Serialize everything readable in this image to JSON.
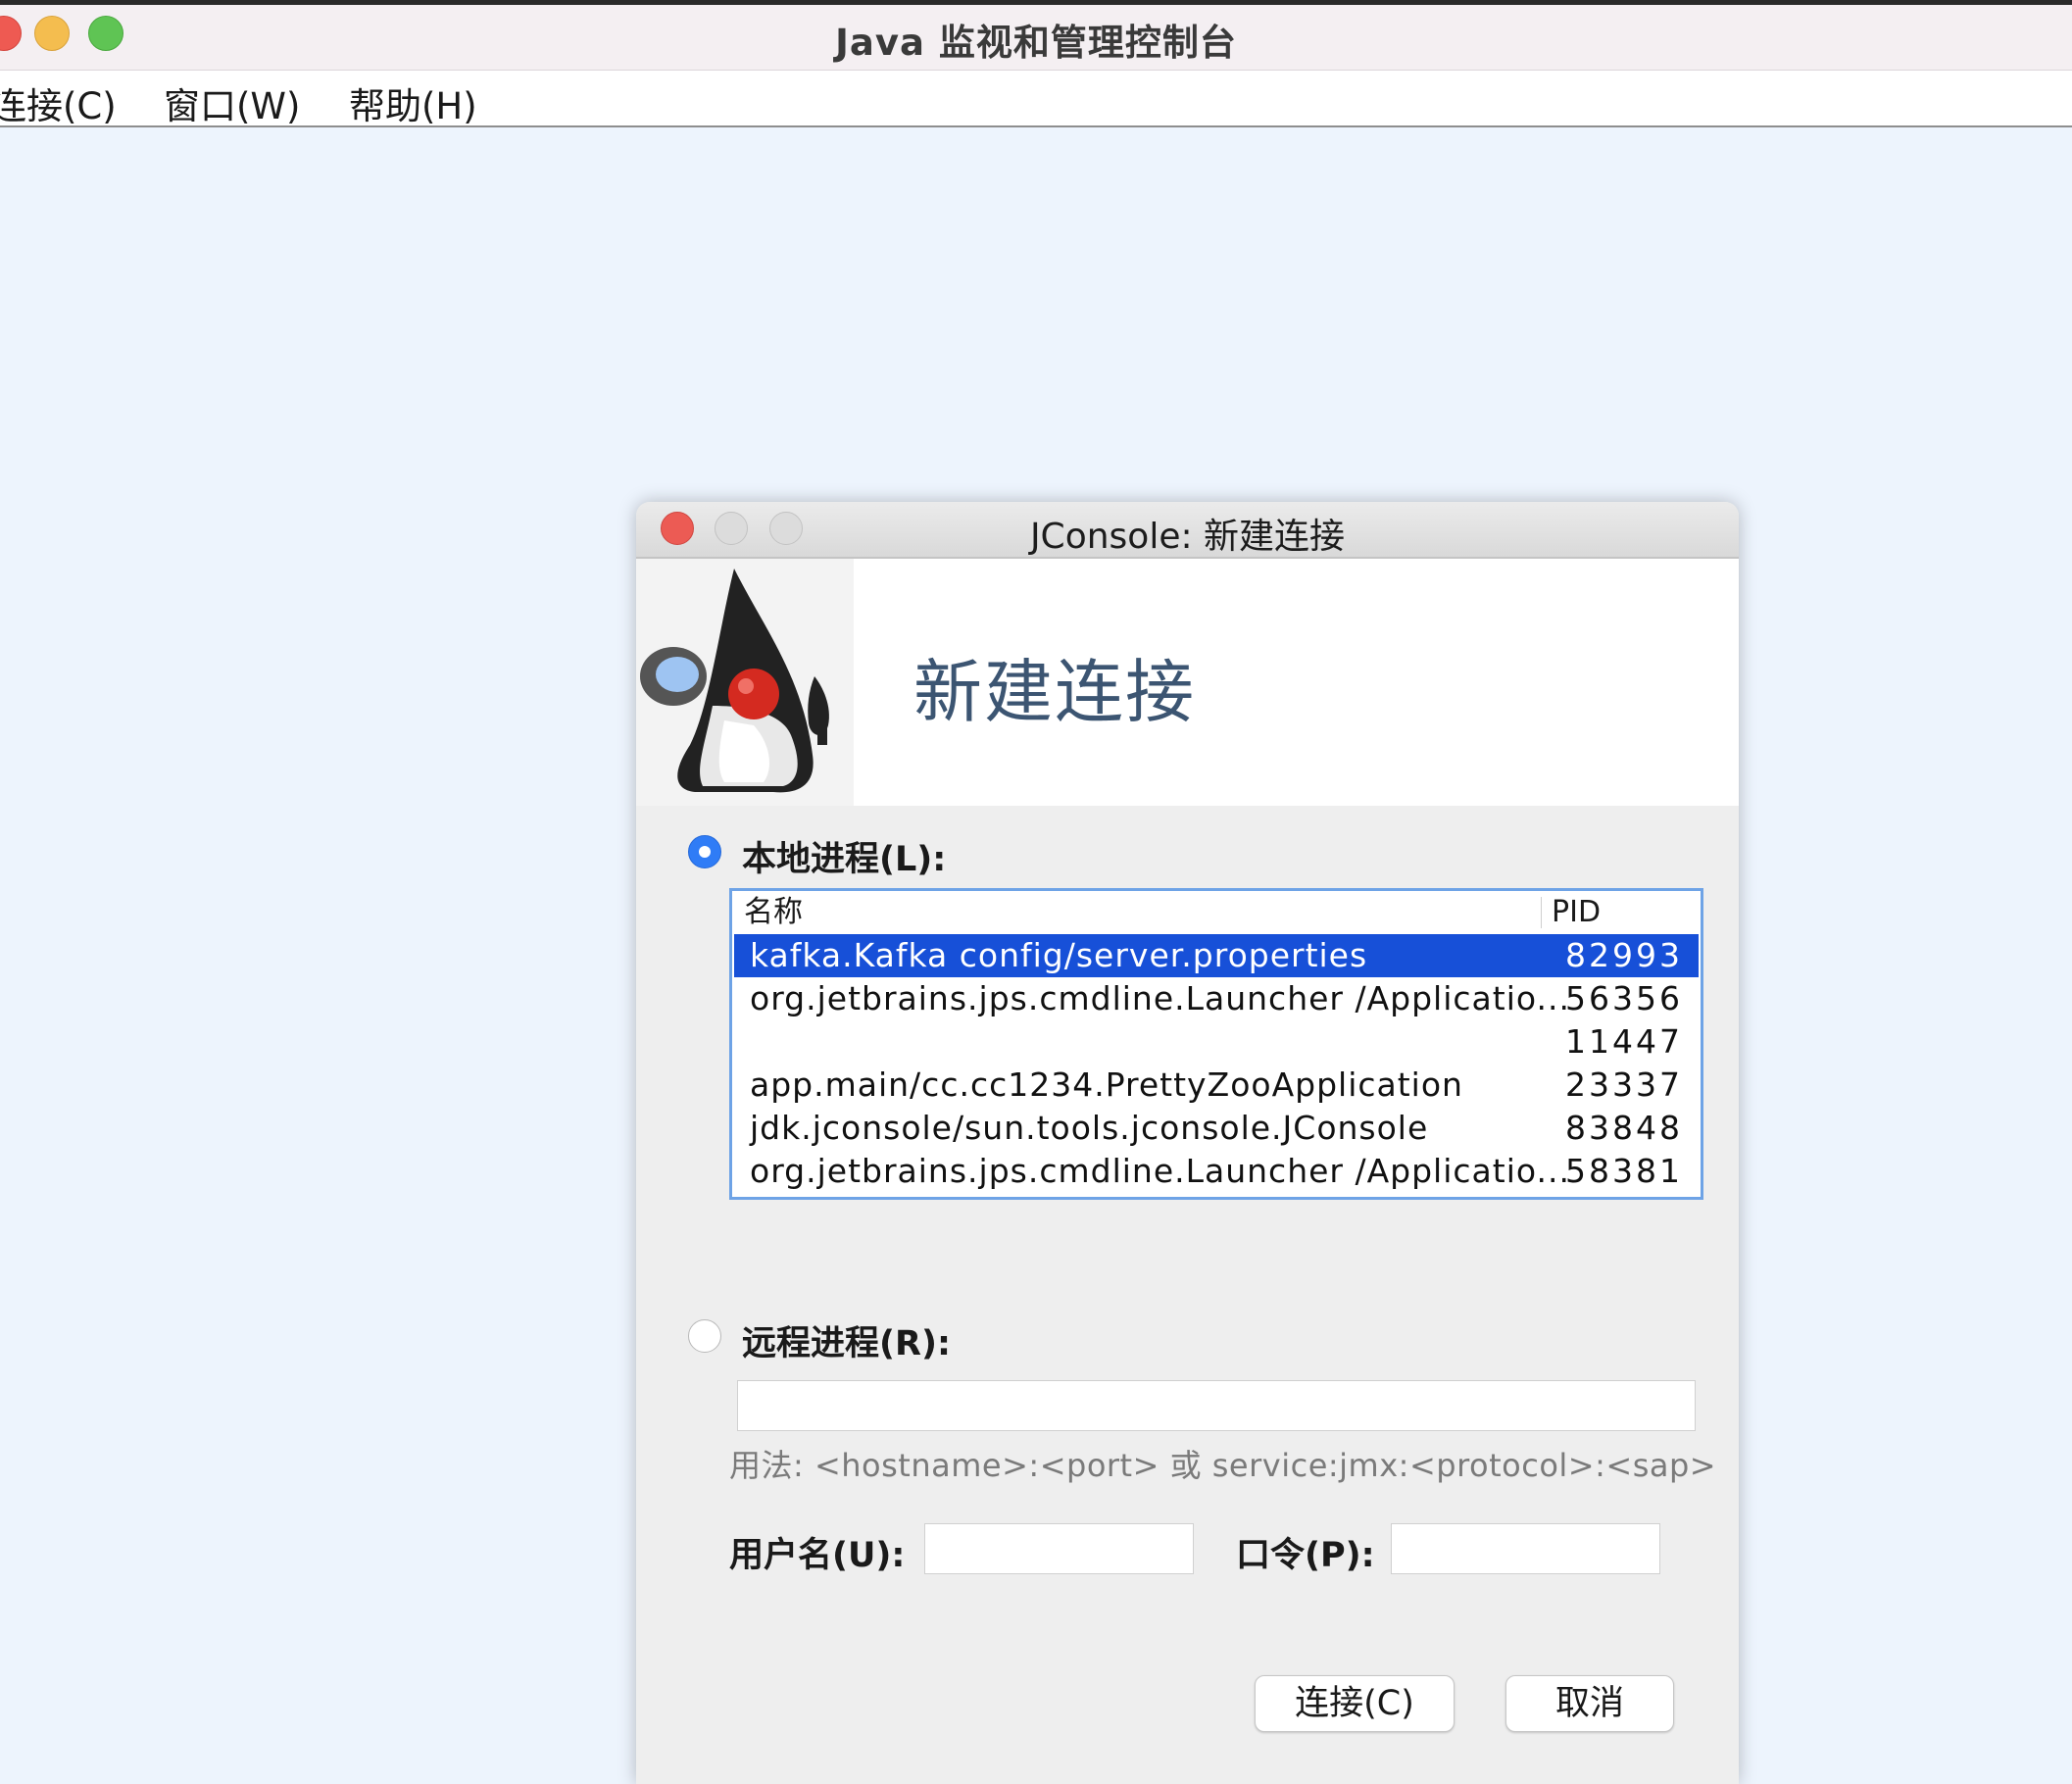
{
  "window": {
    "title": "Java 监视和管理控制台"
  },
  "menubar": {
    "items": [
      {
        "label": "连接(C)"
      },
      {
        "label": "窗口(W)"
      },
      {
        "label": "帮助(H)"
      }
    ]
  },
  "dialog": {
    "title": "JConsole: 新建连接",
    "banner_title": "新建连接",
    "local": {
      "label": "本地进程(L):",
      "selected": true,
      "columns": {
        "name": "名称",
        "pid": "PID"
      },
      "rows": [
        {
          "name": "kafka.Kafka config/server.properties",
          "pid": "82993",
          "selected": true
        },
        {
          "name": "org.jetbrains.jps.cmdline.Launcher /Applicatio...",
          "pid": "56356"
        },
        {
          "name": "",
          "pid": "11447"
        },
        {
          "name": "app.main/cc.cc1234.PrettyZooApplication",
          "pid": "23337"
        },
        {
          "name": "jdk.jconsole/sun.tools.jconsole.JConsole",
          "pid": "83848"
        },
        {
          "name": "org.jetbrains.jps.cmdline.Launcher /Applicatio...",
          "pid": "58381"
        }
      ]
    },
    "remote": {
      "label": "远程进程(R):",
      "selected": false,
      "value": "",
      "hint": "用法: <hostname>:<port> 或 service:jmx:<protocol>:<sap>"
    },
    "credentials": {
      "username_label": "用户名(U):",
      "username_value": "",
      "password_label": "口令(P):",
      "password_value": ""
    },
    "buttons": {
      "connect": "连接(C)",
      "cancel": "取消"
    }
  },
  "colors": {
    "desktop": "#edf4fd",
    "selection": "#1750d8",
    "banner_title": "#3c5572",
    "radio_selected": "#2f7cf6"
  }
}
